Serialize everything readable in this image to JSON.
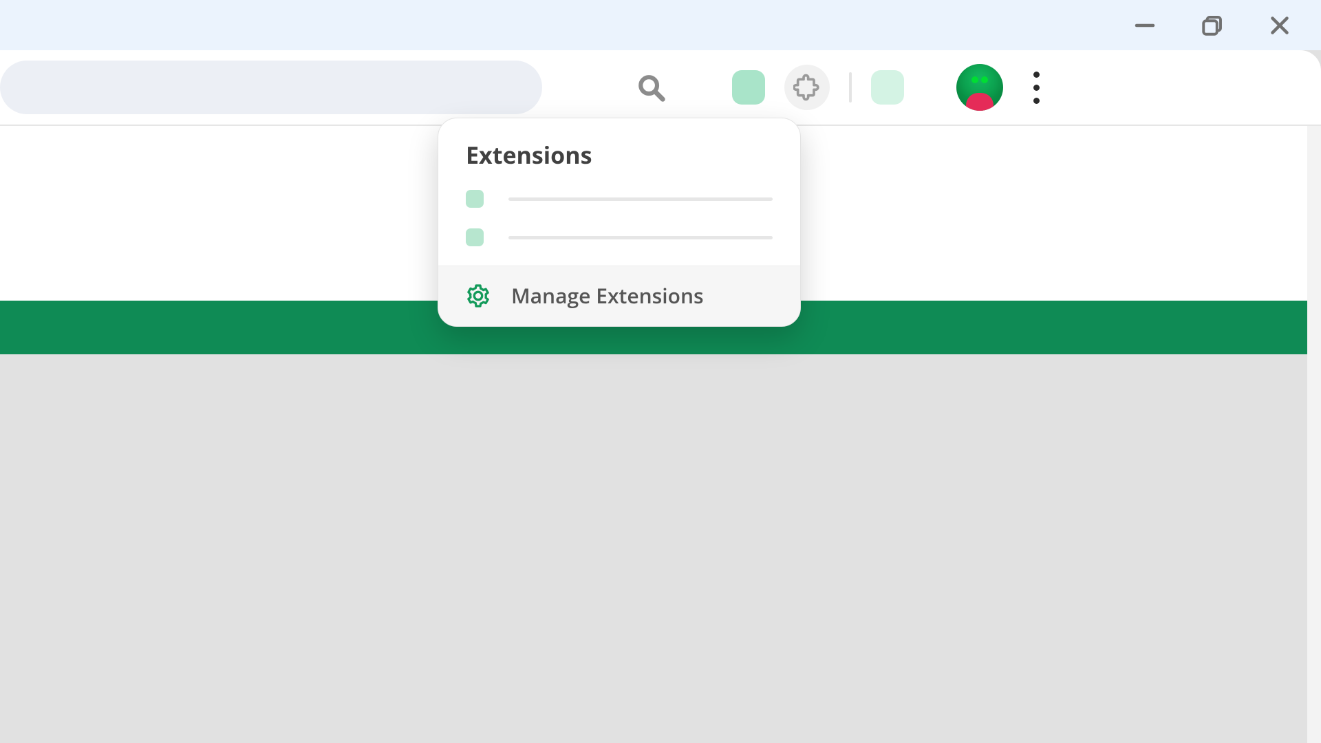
{
  "dropdown": {
    "title": "Extensions",
    "manage_label": "Manage Extensions"
  },
  "colors": {
    "brand_green": "#0f8b55",
    "accent_mint": "#a9e4c9"
  }
}
